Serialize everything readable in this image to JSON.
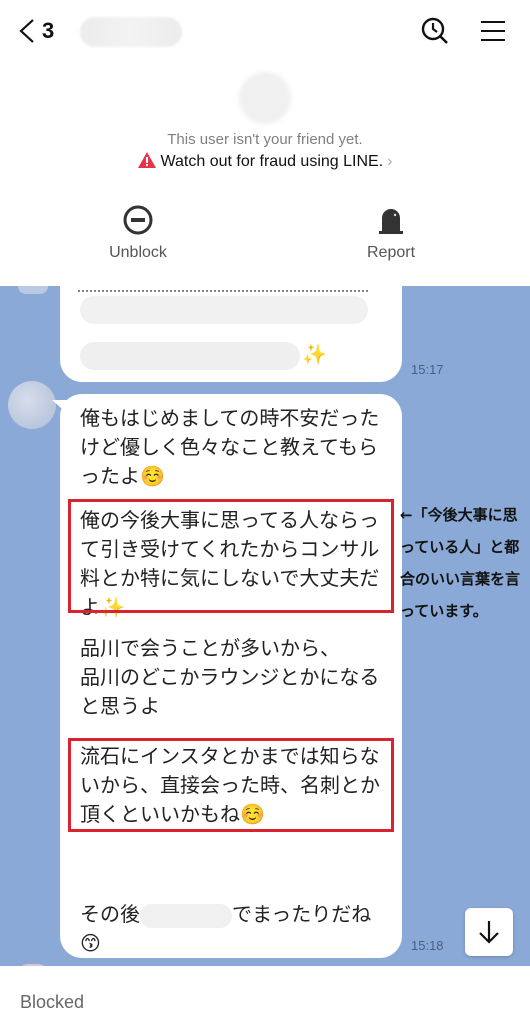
{
  "header": {
    "unread_count": "3",
    "search_icon": "search-history-icon",
    "menu_icon": "hamburger-menu-icon"
  },
  "profile": {
    "not_friend_text": "This user isn't your friend yet.",
    "fraud_warning": "Watch out for fraud using LINE.",
    "fraud_chevron": "›",
    "actions": [
      {
        "label": "Unblock",
        "icon": "minus-circle-icon"
      },
      {
        "label": "Report",
        "icon": "siren-icon"
      }
    ]
  },
  "chat": {
    "messages": [
      {
        "time": "15:17",
        "sparkle": "✨"
      },
      {
        "time": "15:18",
        "paragraphs": [
          {
            "text": "俺もはじめましての時不安だったけど優しく色々なこと教えてもらったよ",
            "emoji": "☺️"
          },
          {
            "text": "俺の今後大事に思ってる人ならって引き受けてくれたからコンサル料とか特に気にしないで大丈夫だよ",
            "emoji": "✨"
          },
          {
            "text": "品川で会うことが多いから、\n品川のどこかラウンジとかになると思うよ",
            "emoji": ""
          },
          {
            "text": "流石にインスタとかまでは知らないから、直接会った時、名刺とか頂くといいかもね",
            "emoji": "☺️"
          },
          {
            "text_before": "その後",
            "text_after": "でまったりだね",
            "emoji": "😙"
          }
        ]
      }
    ],
    "annotation": "←「今後大事に思っている人」と都合のいい言葉を言っています。",
    "highlight_color": "#d9232e",
    "background_color": "#8aa9d6"
  },
  "footer": {
    "status": "Blocked"
  }
}
